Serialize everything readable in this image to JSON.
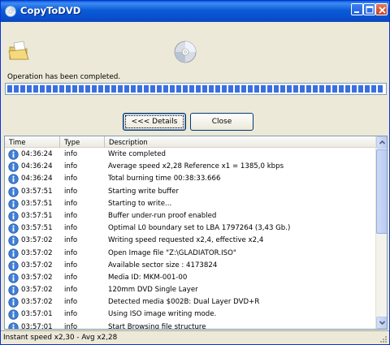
{
  "window": {
    "title": "CopyToDVD"
  },
  "status": {
    "operation": "Operation has been completed.",
    "progress": 1.0
  },
  "buttons": {
    "details": "<<< Details",
    "close": "Close"
  },
  "list": {
    "columns": [
      "Time",
      "Type",
      "Description"
    ],
    "rows": [
      {
        "time": "04:36:24",
        "type": "info",
        "desc": "Write completed"
      },
      {
        "time": "04:36:24",
        "type": "info",
        "desc": "Average speed x2,28 Reference x1 = 1385,0 kbps"
      },
      {
        "time": "04:36:24",
        "type": "info",
        "desc": "Total burning time 00:38:33.666"
      },
      {
        "time": "03:57:51",
        "type": "info",
        "desc": "Starting write buffer"
      },
      {
        "time": "03:57:51",
        "type": "info",
        "desc": "Starting to write..."
      },
      {
        "time": "03:57:51",
        "type": "info",
        "desc": "Buffer under-run proof enabled"
      },
      {
        "time": "03:57:51",
        "type": "info",
        "desc": "Optimal L0 boundary set to LBA 1797264 (3,43 Gb.)"
      },
      {
        "time": "03:57:02",
        "type": "info",
        "desc": "Writing speed requested x2,4, effective x2,4"
      },
      {
        "time": "03:57:02",
        "type": "info",
        "desc": "Open Image file \"Z:\\GLADIATOR.ISO\""
      },
      {
        "time": "03:57:02",
        "type": "info",
        "desc": "Available sector size : 4173824"
      },
      {
        "time": "03:57:02",
        "type": "info",
        "desc": "Media ID: MKM-001-00"
      },
      {
        "time": "03:57:02",
        "type": "info",
        "desc": "120mm DVD Single Layer"
      },
      {
        "time": "03:57:02",
        "type": "info",
        "desc": "Detected media $002B: Dual Layer DVD+R"
      },
      {
        "time": "03:57:01",
        "type": "info",
        "desc": "Using ISO image writing mode."
      },
      {
        "time": "03:57:01",
        "type": "info",
        "desc": "Start Browsing file structure"
      }
    ]
  },
  "statusbar": {
    "text": "Instant speed x2,30 - Avg x2,28"
  },
  "icons": {
    "app": "cd-app-icon",
    "folder": "open-folder-icon",
    "disc": "cd-disc-icon",
    "row": "info-icon",
    "grip": "resize-grip-icon"
  },
  "colors": {
    "titlebar": "#0a5fd8",
    "progress": "#3a6fe0",
    "accent_border": "#0831d9"
  }
}
